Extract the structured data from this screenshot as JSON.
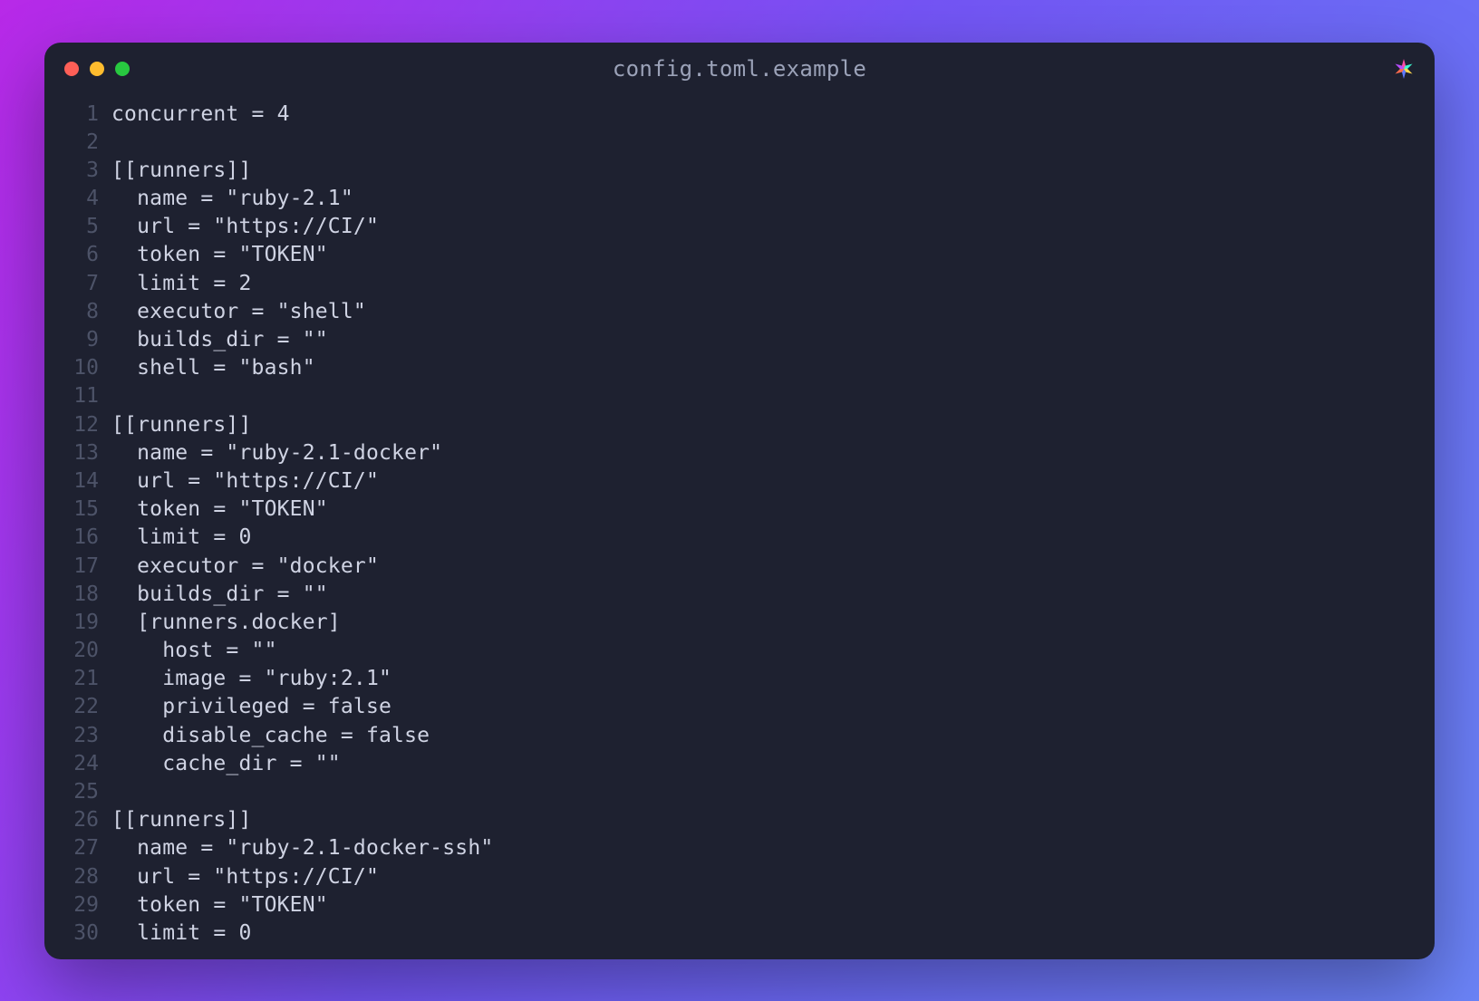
{
  "window": {
    "title": "config.toml.example"
  },
  "colors": {
    "window_bg": "#1e2130",
    "gutter": "#4d5368",
    "text": "#cfd3e3",
    "title": "#9ba2b8",
    "traffic_red": "#fe5f57",
    "traffic_yellow": "#febc2e",
    "traffic_green": "#28c840"
  },
  "code": {
    "lines": [
      "concurrent = 4",
      "",
      "[[runners]]",
      "  name = \"ruby-2.1\"",
      "  url = \"https://CI/\"",
      "  token = \"TOKEN\"",
      "  limit = 2",
      "  executor = \"shell\"",
      "  builds_dir = \"\"",
      "  shell = \"bash\"",
      "",
      "[[runners]]",
      "  name = \"ruby-2.1-docker\"",
      "  url = \"https://CI/\"",
      "  token = \"TOKEN\"",
      "  limit = 0",
      "  executor = \"docker\"",
      "  builds_dir = \"\"",
      "  [runners.docker]",
      "    host = \"\"",
      "    image = \"ruby:2.1\"",
      "    privileged = false",
      "    disable_cache = false",
      "    cache_dir = \"\"",
      "",
      "[[runners]]",
      "  name = \"ruby-2.1-docker-ssh\"",
      "  url = \"https://CI/\"",
      "  token = \"TOKEN\"",
      "  limit = 0"
    ]
  }
}
